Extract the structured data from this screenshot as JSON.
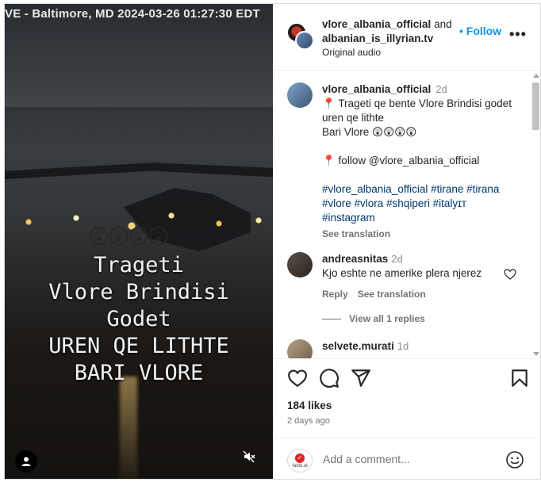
{
  "video": {
    "timestamp": "VE - Baltimore, MD 2024-03-26  01:27:30 EDT",
    "emojis": "😲😲😲😲",
    "overlay_lines": [
      "Trageti",
      "Vlore Brindisi",
      "Godet",
      "UREN QE LITHTE",
      "BARI VLORE"
    ]
  },
  "header": {
    "user1": "vlore_albania_official",
    "and": " and",
    "user2": "albanian_is_illyrian.tv",
    "follow_label": "Follow",
    "audio": "Original audio"
  },
  "caption": {
    "user": "vlore_albania_official",
    "time": "2d",
    "line1": "📍 Trageti qe bente Vlore Brindisi godet",
    "line2": "uren qe lithte",
    "line3": "Bari Vlore 😲😲😲😲",
    "line4": "📍 follow @vlore_albania_official",
    "tags1": "#vlore_albania_official #tirane #tirana",
    "tags2": "#vlore #vlora #shqiperi #italyɪт",
    "tags3": "#instagram",
    "see_translation": "See translation"
  },
  "comments": [
    {
      "user": "andreasnitas",
      "time": "2d",
      "text": "Kjo eshte ne amerike plera njerez",
      "reply": "Reply",
      "see_translation": "See translation"
    },
    {
      "user": "selvete.murati",
      "time": "1d"
    }
  ],
  "view_replies": "View all 1 replies",
  "actions": {
    "likes": "184 likes",
    "ago": "2 days ago"
  },
  "composer": {
    "placeholder": "Add a comment...",
    "avatar_label": "fakte.al",
    "avatar_mark": "✓"
  }
}
